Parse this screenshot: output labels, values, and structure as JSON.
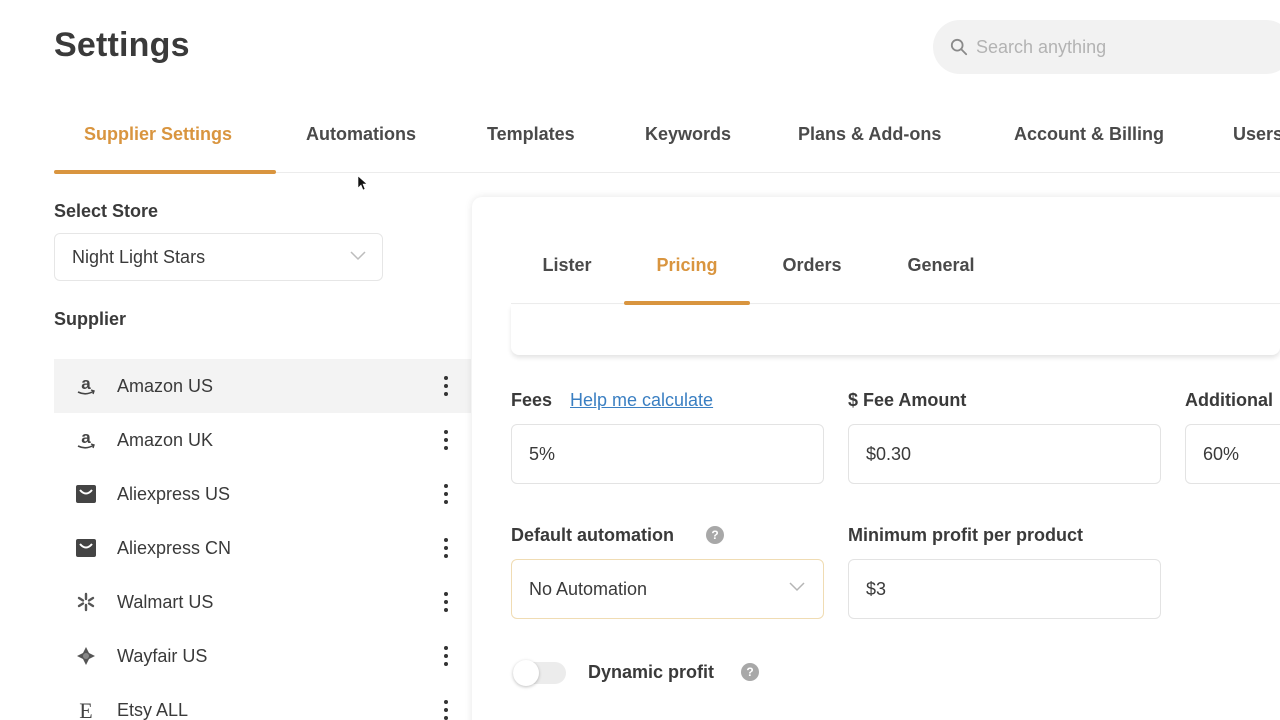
{
  "header": {
    "title": "Settings",
    "search_placeholder": "Search anything"
  },
  "top_tabs": [
    {
      "label": "Supplier Settings",
      "active": true
    },
    {
      "label": "Automations"
    },
    {
      "label": "Templates"
    },
    {
      "label": "Keywords"
    },
    {
      "label": "Plans & Add-ons"
    },
    {
      "label": "Account & Billing"
    },
    {
      "label": "Users"
    }
  ],
  "sidebar": {
    "select_store_label": "Select Store",
    "store_value": "Night Light Stars",
    "supplier_label": "Supplier",
    "suppliers": [
      {
        "name": "Amazon US",
        "icon": "amazon-icon",
        "active": true
      },
      {
        "name": "Amazon UK",
        "icon": "amazon-icon"
      },
      {
        "name": "Aliexpress US",
        "icon": "aliexpress-icon"
      },
      {
        "name": "Aliexpress CN",
        "icon": "aliexpress-icon"
      },
      {
        "name": "Walmart US",
        "icon": "walmart-icon"
      },
      {
        "name": "Wayfair US",
        "icon": "wayfair-icon"
      },
      {
        "name": "Etsy ALL",
        "icon": "etsy-icon"
      }
    ]
  },
  "panel": {
    "tabs": [
      {
        "label": "Lister"
      },
      {
        "label": "Pricing",
        "active": true
      },
      {
        "label": "Orders"
      },
      {
        "label": "General"
      }
    ],
    "fees": {
      "label": "Fees",
      "help_link": "Help me calculate",
      "value": "5%"
    },
    "fee_amount": {
      "label": "$ Fee Amount",
      "value": "$0.30"
    },
    "additional": {
      "label": "Additional",
      "value": "60%"
    },
    "default_automation": {
      "label": "Default automation",
      "value": "No Automation"
    },
    "min_profit": {
      "label": "Minimum profit per product",
      "value": "$3"
    },
    "dynamic_profit": {
      "label": "Dynamic profit",
      "enabled": false
    }
  },
  "colors": {
    "accent": "#d9953f",
    "link": "#3a7fc2",
    "text": "#3a3a3a"
  }
}
